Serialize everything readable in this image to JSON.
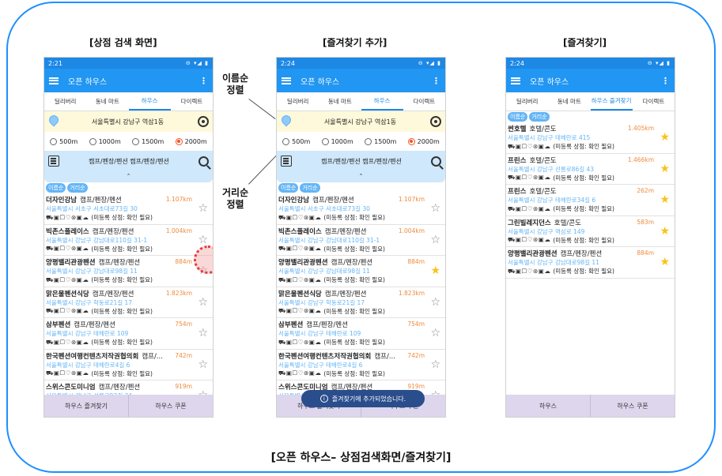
{
  "captions": {
    "screen1": "[상점 검색 화면]",
    "screen2": "[즐겨찾기 추가]",
    "screen3": "[즐겨찾기]",
    "bottom": "[오픈 하우스– 상점검색화면/즐겨찾기]"
  },
  "annotations": {
    "sort_by_name": [
      "이름순",
      "정렬"
    ],
    "sort_by_distance": [
      "거리순",
      "정렬"
    ]
  },
  "app": {
    "title": "오픈 하우스",
    "location": "서울특별시 강남구 역삼1동",
    "category_text": "캠프/펜장/펜션 캠프/펜장/펜션",
    "collapse_glyph": "⌃",
    "sort_buttons": [
      "이름순",
      "거리순"
    ],
    "radius_options": [
      "500m",
      "1000m",
      "1500m",
      "2000m"
    ],
    "selected_radius": "2000m",
    "facility_icons": [
      "atv-icon",
      "tv-icon",
      "parking-icon",
      "bbq-icon",
      "wifi-icon",
      "pet-icon",
      "car-icon"
    ],
    "facility_glyphs": "⛟▣☐♡⊛▣☁",
    "accent_color": "#2196f3"
  },
  "screens": [
    {
      "time": "2:21",
      "tabs": [
        "딜리버리",
        "동네 마트",
        "하우스",
        "다이렉트"
      ],
      "active_tab": 2,
      "items": [
        {
          "name": "더자인강남",
          "category": "캠프/펜장/펜션",
          "distance": "1.107km",
          "address": "서울특별시 서초구 서초대로73길 30",
          "note": "(미등록 상점: 확인 필요)",
          "starred": false
        },
        {
          "name": "빅존스플레이스",
          "category": "캠프/펜장/펜션",
          "distance": "1.004km",
          "address": "서울특별시 강남구 강남대로110길 31-1",
          "note": "(미등록 상점: 확인 필요)",
          "starred": false
        },
        {
          "name": "양평밸리관광펜션",
          "category": "캠프/펜장/펜션",
          "distance": "884m",
          "address": "서울특별시 강남구 강남대로98길 11",
          "note": "(미등록 상점: 확인 필요)",
          "starred": false
        },
        {
          "name": "맑은물펜션식당",
          "category": "캠프/펜장/펜션",
          "distance": "1.823km",
          "address": "서울특별시 강남구 학동로21길 17",
          "note": "(미등록 상점: 확인 필요)",
          "starred": false
        },
        {
          "name": "삼부펜션",
          "category": "캠프/펜장/펜션",
          "distance": "754m",
          "address": "서울특별시 강남구 테헤란로 109",
          "note": "(미등록 상점: 확인 필요)",
          "starred": false
        },
        {
          "name": "한국펜션여행컨텐츠저작권협의회",
          "category": "캠프/...",
          "distance": "742m",
          "address": "서울특별시 강남구 테헤란로4길 6",
          "note": "(미등록 상점: 확인 필요)",
          "starred": false
        },
        {
          "name": "스위스콘도미니엄",
          "category": "캠프/펜장/펜션",
          "distance": "919m",
          "address": "서울특별시 강남구 선릉로93길 34",
          "note": "",
          "starred": false
        }
      ],
      "bottom_buttons": [
        "하우스 즐겨찾기",
        "하우스 쿠폰"
      ]
    },
    {
      "time": "2:24",
      "tabs": [
        "딜리버리",
        "동네 마트",
        "하우스",
        "다이렉트"
      ],
      "active_tab": 2,
      "items": [
        {
          "name": "더자인강남",
          "category": "캠프/펜장/펜션",
          "distance": "1.107km",
          "address": "서울특별시 서초구 서초대로73길 30",
          "note": "(미등록 상점: 확인 필요)",
          "starred": false
        },
        {
          "name": "빅존스플레이스",
          "category": "캠프/펜장/펜션",
          "distance": "1.004km",
          "address": "서울특별시 강남구 강남대로110길 31-1",
          "note": "(미등록 상점: 확인 필요)",
          "starred": false
        },
        {
          "name": "양평밸리관광펜션",
          "category": "캠프/펜장/펜션",
          "distance": "884m",
          "address": "서울특별시 강남구 강남대로98길 11",
          "note": "(미등록 상점: 확인 필요)",
          "starred": true
        },
        {
          "name": "맑은물펜션식당",
          "category": "캠프/펜장/펜션",
          "distance": "1.823km",
          "address": "서울특별시 강남구 학동로21길 17",
          "note": "(미등록 상점: 확인 필요)",
          "starred": false
        },
        {
          "name": "삼부펜션",
          "category": "캠프/펜장/펜션",
          "distance": "754m",
          "address": "서울특별시 강남구 테헤란로 109",
          "note": "(미등록 상점: 확인 필요)",
          "starred": false
        },
        {
          "name": "한국펜션여행컨텐츠저작권협의회",
          "category": "캠프/...",
          "distance": "742m",
          "address": "서울특별시 강남구 테헤란로4길 6",
          "note": "(미등록 상점: 확인 필요)",
          "starred": false
        },
        {
          "name": "스위스콘도미니엄",
          "category": "캠프/펜장/펜션",
          "distance": "919m",
          "address": "서울특별시 강남구 선릉로93길 34",
          "note": "",
          "starred": false
        }
      ],
      "bottom_buttons": [
        "하우스 즐겨찾기",
        "하우스 쿠폰"
      ],
      "toast": "즐겨찾기에 추가되었습니다."
    },
    {
      "time": "2:24",
      "tabs": [
        "딜리버리",
        "동네 마트",
        "하우스 즐겨찾기",
        "다이렉트"
      ],
      "active_tab": 2,
      "items": [
        {
          "name": "썬호텔",
          "category": "호텔/콘도",
          "distance": "1.405km",
          "address": "서울특별시 강남구 테헤란로 415",
          "note": "(미등록 상점: 확인 필요)",
          "starred": true
        },
        {
          "name": "프린스",
          "category": "호텔/콘도",
          "distance": "1.466km",
          "address": "서울특별시 강남구 선릉로86길 43",
          "note": "(미등록 상점: 확인 필요)",
          "starred": true
        },
        {
          "name": "프린스",
          "category": "호텔/콘도",
          "distance": "262m",
          "address": "서울특별시 강남구 테헤란로34길 6",
          "note": "(미등록 상점: 확인 필요)",
          "starred": true
        },
        {
          "name": "그린빌레지던스",
          "category": "호텔/콘도",
          "distance": "583m",
          "address": "서울특별시 강남구 역삼로 149",
          "note": "(미등록 상점: 확인 필요)",
          "starred": true
        },
        {
          "name": "양평밸리관광펜션",
          "category": "캠프/펜장/펜션",
          "distance": "884m",
          "address": "서울특별시 강남구 강남대로98길 11",
          "note": "(미등록 상점: 확인 필요)",
          "starred": true
        }
      ],
      "bottom_buttons": [
        "하우스",
        "하우스 쿠폰"
      ]
    }
  ]
}
